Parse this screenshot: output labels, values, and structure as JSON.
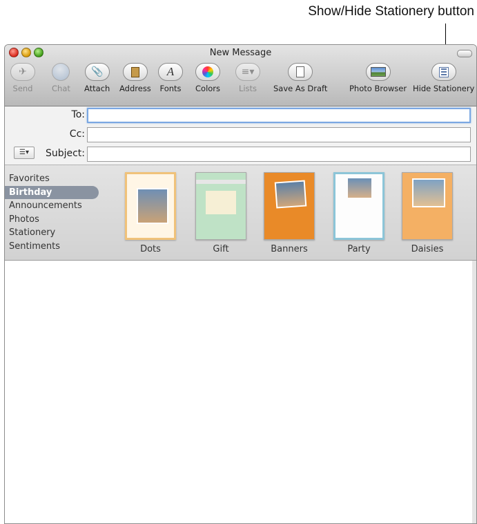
{
  "callout": {
    "text": "Show/Hide Stationery button"
  },
  "window": {
    "title": "New Message"
  },
  "toolbar": {
    "send": "Send",
    "chat": "Chat",
    "attach": "Attach",
    "address": "Address",
    "fonts": "Fonts",
    "colors": "Colors",
    "lists": "Lists",
    "save_draft": "Save As Draft",
    "photo_browser": "Photo Browser",
    "hide_stationery": "Hide Stationery"
  },
  "fields": {
    "to_label": "To:",
    "to_value": "",
    "cc_label": "Cc:",
    "cc_value": "",
    "subject_label": "Subject:",
    "subject_value": ""
  },
  "stationery": {
    "categories": [
      "Favorites",
      "Birthday",
      "Announcements",
      "Photos",
      "Stationery",
      "Sentiments"
    ],
    "selected_category": "Birthday",
    "templates": [
      "Dots",
      "Gift",
      "Banners",
      "Party",
      "Daisies"
    ]
  }
}
